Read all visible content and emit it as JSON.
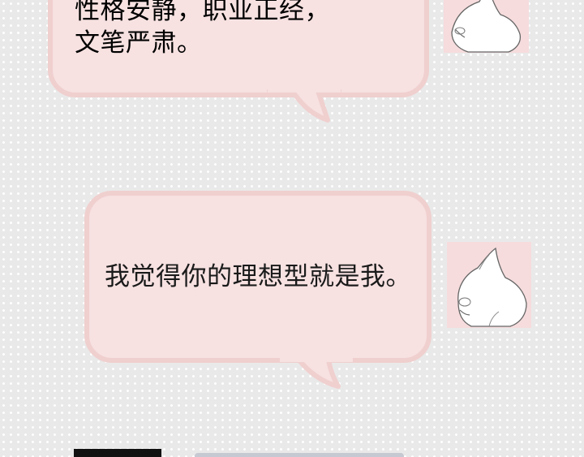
{
  "bubbles": [
    {
      "text": "性格安静，职业正经，\n文笔严肃。"
    },
    {
      "text": "我觉得你的理想型就是我。"
    }
  ],
  "colors": {
    "background": "#e9e9e9",
    "bubble_fill": "#f7e1e1",
    "bubble_border": "#f0cfcf",
    "avatar_bg": "#f6dcdd"
  },
  "avatars": [
    "white-cat-icon",
    "white-cat-icon"
  ]
}
